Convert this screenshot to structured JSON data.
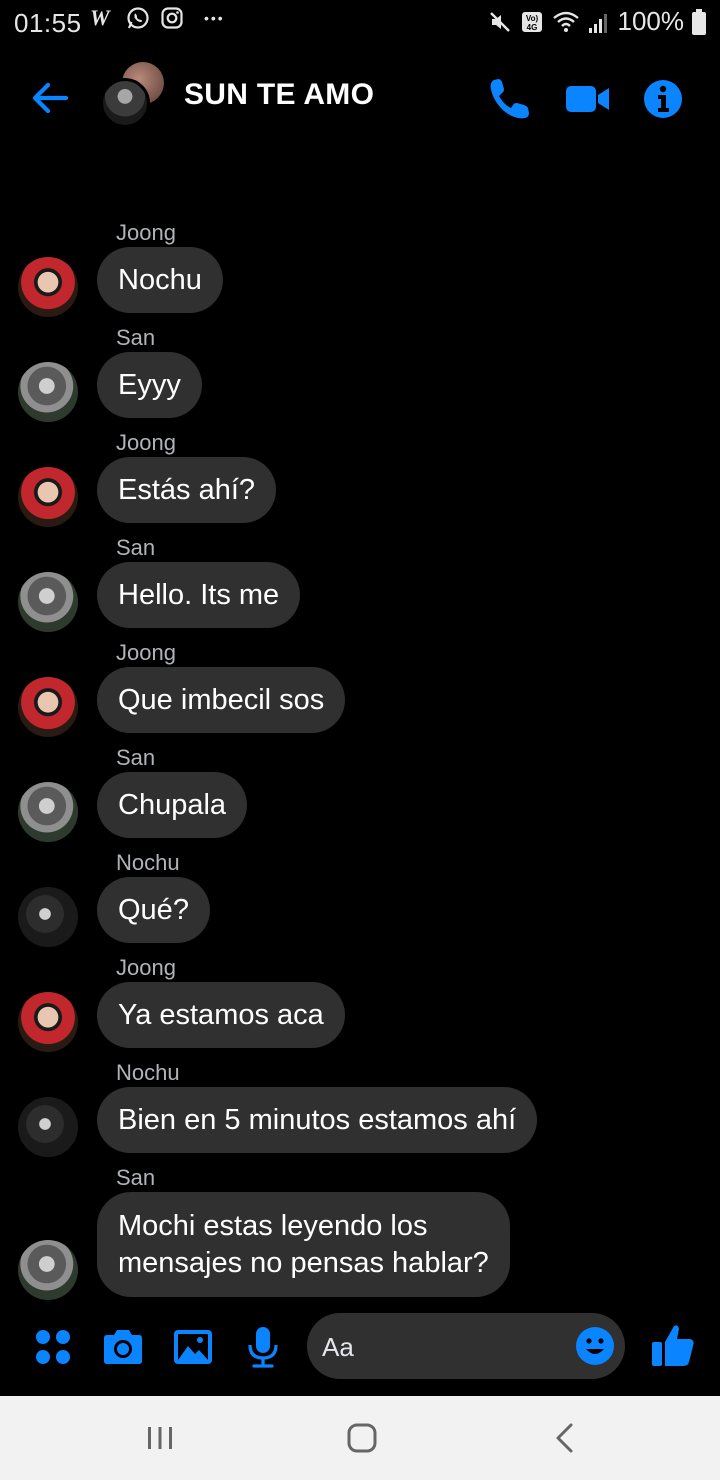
{
  "status_bar": {
    "time": "01:55",
    "more": "•••",
    "battery": "100%"
  },
  "header": {
    "title": "SUN TE AMO"
  },
  "messages": [
    {
      "sender": "Joong",
      "text": "Nochu",
      "avatar": "joong"
    },
    {
      "sender": "San",
      "text": "Eyyy",
      "avatar": "san"
    },
    {
      "sender": "Joong",
      "text": "Estás ahí?",
      "avatar": "joong"
    },
    {
      "sender": "San",
      "text": "Hello. Its me",
      "avatar": "san"
    },
    {
      "sender": "Joong",
      "text": "Que imbecil sos",
      "avatar": "joong"
    },
    {
      "sender": "San",
      "text": "Chupala",
      "avatar": "san"
    },
    {
      "sender": "Nochu",
      "text": "Qué?",
      "avatar": "nochu"
    },
    {
      "sender": "Joong",
      "text": "Ya estamos aca",
      "avatar": "joong"
    },
    {
      "sender": "Nochu",
      "text": "Bien en 5 minutos estamos ahí",
      "avatar": "nochu"
    },
    {
      "sender": "San",
      "text_lines": [
        "Mochi estas leyendo los",
        "mensajes no pensas hablar?"
      ],
      "avatar": "san"
    }
  ],
  "composer": {
    "placeholder": "Aa"
  },
  "colors": {
    "accent": "#0a84ff",
    "bubble": "#303030",
    "background": "#000000",
    "sender_label": "#b0b3b8"
  }
}
